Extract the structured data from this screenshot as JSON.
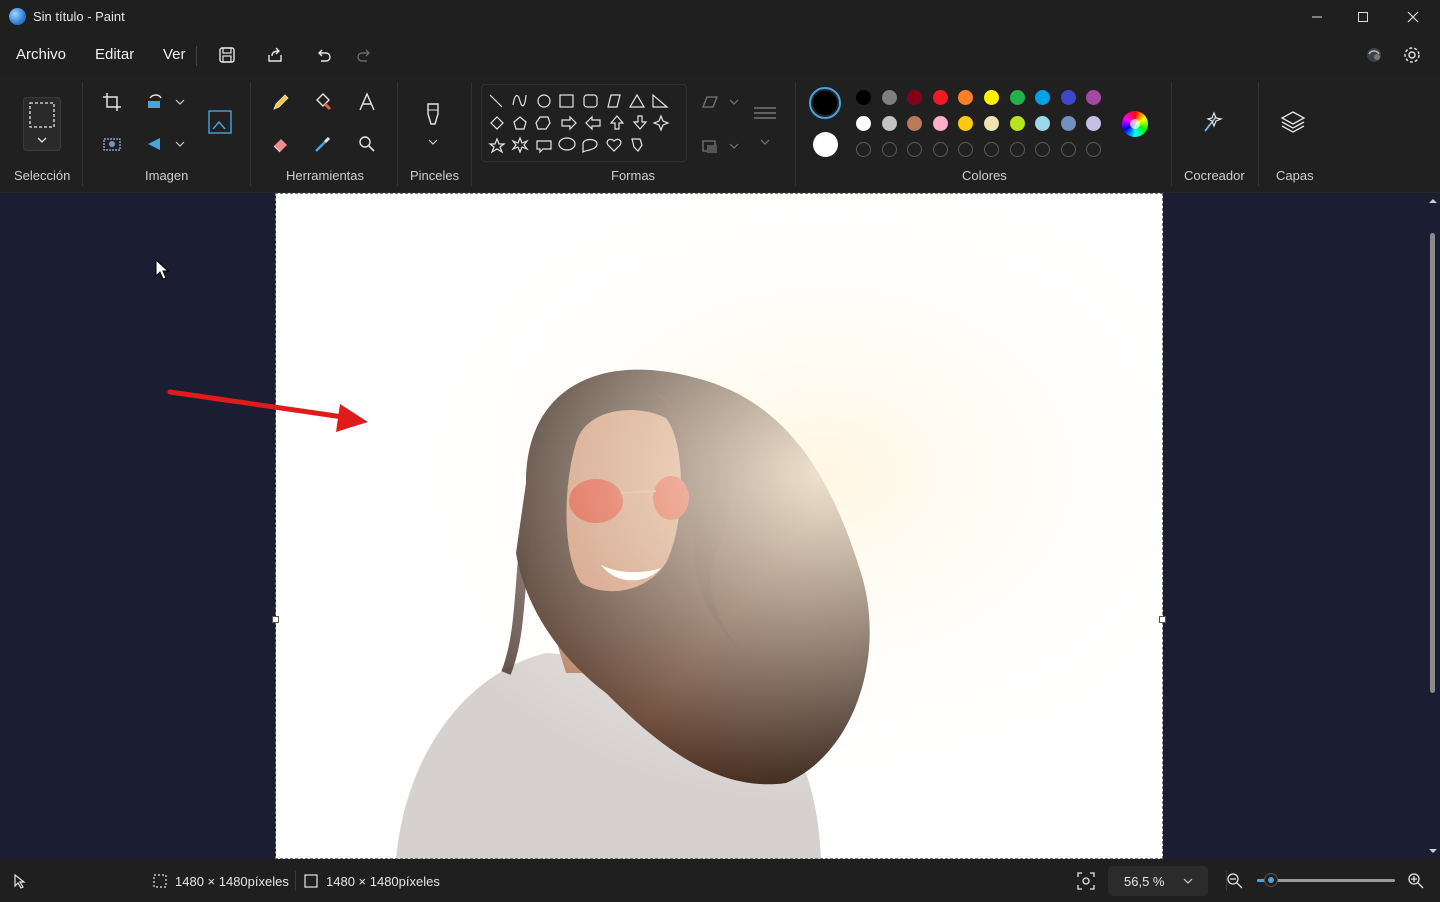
{
  "window": {
    "title": "Sin título - Paint"
  },
  "menu": {
    "file": "Archivo",
    "edit": "Editar",
    "view": "Ver"
  },
  "ribbon": {
    "selection_label": "Selección",
    "image_label": "Imagen",
    "tools_label": "Herramientas",
    "brushes_label": "Pinceles",
    "shapes_label": "Formas",
    "colors_label": "Colores",
    "cocreator_label": "Cocreador",
    "layers_label": "Capas"
  },
  "colors": {
    "primary": "#000000",
    "secondary": "#ffffff",
    "row1": [
      "#000000",
      "#7f7f7f",
      "#880015",
      "#ed1c24",
      "#ff7f27",
      "#fff200",
      "#22b14c",
      "#00a2e8",
      "#3f48cc",
      "#a349a4"
    ],
    "row2": [
      "#ffffff",
      "#c3c3c3",
      "#b97a57",
      "#ffaec9",
      "#ffc90e",
      "#efe4b0",
      "#b5e61d",
      "#99d9ea",
      "#7092be",
      "#c8bfe7"
    ],
    "empty_count": 10
  },
  "status": {
    "selection_size": "1480 × 1480píxeles",
    "canvas_size": "1480 × 1480píxeles",
    "zoom": "56,5 %",
    "zoom_slider_fraction": 0.1
  }
}
